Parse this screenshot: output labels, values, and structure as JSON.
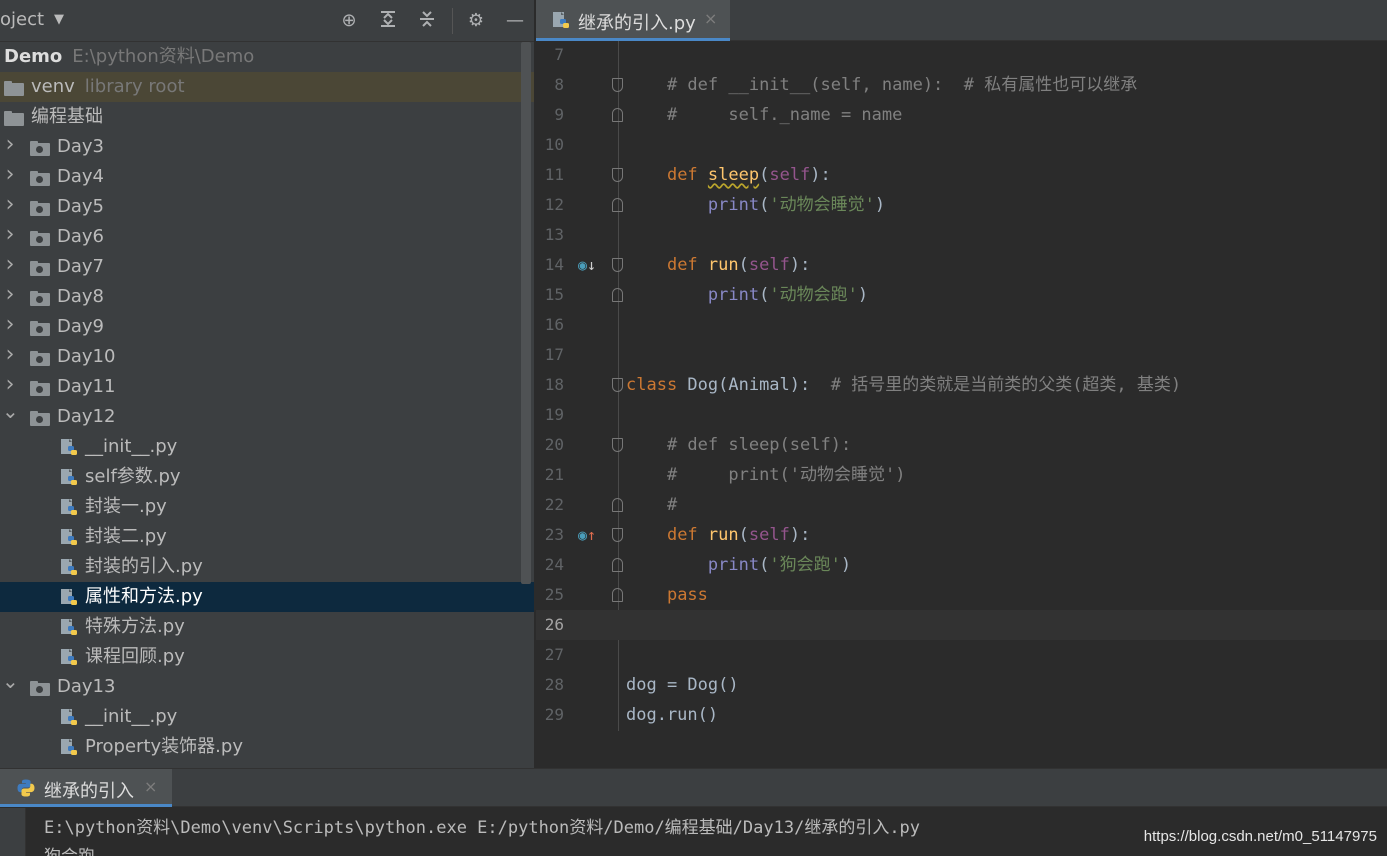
{
  "project": {
    "title": "oject",
    "dropdown_icon": "chevron-down-icon",
    "tree": [
      {
        "depth": 0,
        "type": "module",
        "name": "Demo",
        "hint": "E:\\python资料\\Demo",
        "bold": true
      },
      {
        "depth": 0,
        "type": "folder",
        "name": "venv",
        "hint": "library root",
        "selected": "venv"
      },
      {
        "depth": 0,
        "type": "folder",
        "name": "编程基础"
      },
      {
        "depth": 1,
        "type": "folder",
        "name": "Day3",
        "arrow": "collapsed"
      },
      {
        "depth": 1,
        "type": "folder",
        "name": "Day4",
        "arrow": "collapsed"
      },
      {
        "depth": 1,
        "type": "folder",
        "name": "Day5",
        "arrow": "collapsed"
      },
      {
        "depth": 1,
        "type": "folder",
        "name": "Day6",
        "arrow": "collapsed"
      },
      {
        "depth": 1,
        "type": "folder",
        "name": "Day7",
        "arrow": "collapsed"
      },
      {
        "depth": 1,
        "type": "folder",
        "name": "Day8",
        "arrow": "collapsed"
      },
      {
        "depth": 1,
        "type": "folder",
        "name": "Day9",
        "arrow": "collapsed"
      },
      {
        "depth": 1,
        "type": "folder",
        "name": "Day10",
        "arrow": "collapsed"
      },
      {
        "depth": 1,
        "type": "folder",
        "name": "Day11",
        "arrow": "collapsed"
      },
      {
        "depth": 1,
        "type": "folder",
        "name": "Day12",
        "arrow": "expanded"
      },
      {
        "depth": 2,
        "type": "py",
        "name": "__init__.py"
      },
      {
        "depth": 2,
        "type": "py",
        "name": "self参数.py"
      },
      {
        "depth": 2,
        "type": "py",
        "name": "封装一.py"
      },
      {
        "depth": 2,
        "type": "py",
        "name": "封装二.py"
      },
      {
        "depth": 2,
        "type": "py",
        "name": "封装的引入.py"
      },
      {
        "depth": 2,
        "type": "py",
        "name": "属性和方法.py",
        "selected": "file"
      },
      {
        "depth": 2,
        "type": "py",
        "name": "特殊方法.py"
      },
      {
        "depth": 2,
        "type": "py",
        "name": "课程回顾.py"
      },
      {
        "depth": 1,
        "type": "folder",
        "name": "Day13",
        "arrow": "expanded"
      },
      {
        "depth": 2,
        "type": "py",
        "name": "__init__.py"
      },
      {
        "depth": 2,
        "type": "py",
        "name": "Property装饰器.py"
      }
    ]
  },
  "editor": {
    "tab_label": "继承的引入.py",
    "tab_close": "×",
    "current_line": 26,
    "lines": [
      {
        "n": 7,
        "tokens": []
      },
      {
        "n": 8,
        "fold": "down",
        "tokens": [
          [
            "",
            "    "
          ],
          [
            "cm",
            "# def __init__(self, name):  # 私有属性也可以继承"
          ]
        ]
      },
      {
        "n": 9,
        "fold": "up",
        "tokens": [
          [
            "",
            "    "
          ],
          [
            "cm",
            "#     self._name = name"
          ]
        ]
      },
      {
        "n": 10,
        "tokens": []
      },
      {
        "n": 11,
        "fold": "down",
        "tokens": [
          [
            "",
            "    "
          ],
          [
            "kw",
            "def "
          ],
          [
            "fn sq",
            "sleep"
          ],
          [
            "",
            "("
          ],
          [
            "self",
            "self"
          ],
          [
            "",
            "):"
          ]
        ]
      },
      {
        "n": 12,
        "fold": "up",
        "tokens": [
          [
            "",
            "        "
          ],
          [
            "bi",
            "print"
          ],
          [
            "",
            "("
          ],
          [
            "str",
            "'动物会睡觉'"
          ],
          [
            "",
            ")"
          ]
        ]
      },
      {
        "n": 13,
        "tokens": []
      },
      {
        "n": 14,
        "fold": "down",
        "gutter": "overridden",
        "tokens": [
          [
            "",
            "    "
          ],
          [
            "kw",
            "def "
          ],
          [
            "fn",
            "run"
          ],
          [
            "",
            "("
          ],
          [
            "self",
            "self"
          ],
          [
            "",
            "):"
          ]
        ]
      },
      {
        "n": 15,
        "fold": "up",
        "tokens": [
          [
            "",
            "        "
          ],
          [
            "bi",
            "print"
          ],
          [
            "",
            "("
          ],
          [
            "str",
            "'动物会跑'"
          ],
          [
            "",
            ")"
          ]
        ]
      },
      {
        "n": 16,
        "tokens": []
      },
      {
        "n": 17,
        "tokens": []
      },
      {
        "n": 18,
        "fold": "down",
        "tokens": [
          [
            "kw",
            "class "
          ],
          [
            "",
            "Dog(Animal):  "
          ],
          [
            "cm",
            "# 括号里的类就是当前类的父类(超类, 基类)"
          ]
        ]
      },
      {
        "n": 19,
        "tokens": []
      },
      {
        "n": 20,
        "fold": "down",
        "tokens": [
          [
            "",
            "    "
          ],
          [
            "cm",
            "# def sleep(self):"
          ]
        ]
      },
      {
        "n": 21,
        "tokens": [
          [
            "",
            "    "
          ],
          [
            "cm",
            "#     print('动物会睡觉')"
          ]
        ]
      },
      {
        "n": 22,
        "fold": "up",
        "tokens": [
          [
            "",
            "    "
          ],
          [
            "cm",
            "#"
          ]
        ]
      },
      {
        "n": 23,
        "fold": "down",
        "gutter": "overrides",
        "tokens": [
          [
            "",
            "    "
          ],
          [
            "kw",
            "def "
          ],
          [
            "fn",
            "run"
          ],
          [
            "",
            "("
          ],
          [
            "self",
            "self"
          ],
          [
            "",
            "):"
          ]
        ]
      },
      {
        "n": 24,
        "fold": "up",
        "tokens": [
          [
            "",
            "        "
          ],
          [
            "bi",
            "print"
          ],
          [
            "",
            "("
          ],
          [
            "str",
            "'狗会跑'"
          ],
          [
            "",
            ")"
          ]
        ]
      },
      {
        "n": 25,
        "fold": "up",
        "tokens": [
          [
            "",
            "    "
          ],
          [
            "kw",
            "pass"
          ]
        ]
      },
      {
        "n": 26,
        "tokens": []
      },
      {
        "n": 27,
        "tokens": []
      },
      {
        "n": 28,
        "tokens": [
          [
            "",
            "dog = Dog()"
          ]
        ]
      },
      {
        "n": 29,
        "tokens": [
          [
            "",
            "dog.run()"
          ]
        ]
      }
    ]
  },
  "run": {
    "tab_label": "继承的引入",
    "tab_close": "×",
    "command": "E:\\python资料\\Demo\\venv\\Scripts\\python.exe E:/python资料/Demo/编程基础/Day13/继承的引入.py",
    "output": "狗会跑"
  },
  "watermark": "https://blog.csdn.net/m0_51147975",
  "colors": {
    "accent": "#4a88c7",
    "keyword": "#cc7832",
    "function": "#ffc66d",
    "string": "#6a8759",
    "comment": "#808080",
    "self": "#94558d",
    "builtin": "#8888c6",
    "selection_file": "#0d293e",
    "selection_venv": "#4b4736"
  }
}
